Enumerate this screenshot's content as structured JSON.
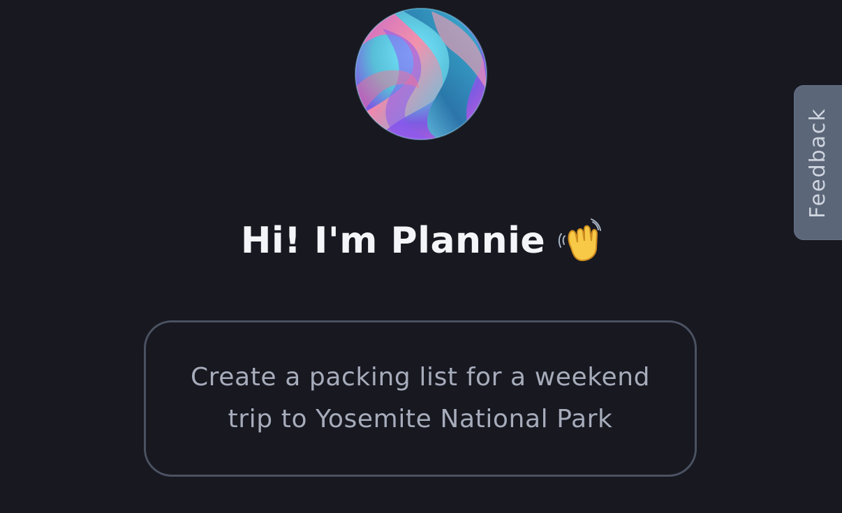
{
  "assistant": {
    "name_heading": "Hi! I'm Plannie",
    "avatar_icon": "gradient-orb-avatar",
    "greeting_icon": "waving-hand-icon"
  },
  "suggestion": {
    "text": "Create a packing list for a weekend trip to Yosemite National Park"
  },
  "feedback": {
    "label": "Feedback"
  },
  "colors": {
    "background": "#171820",
    "card_border": "#4b5261",
    "feedback_tab": "#5b6678",
    "heading_text": "#f4f5f8",
    "suggestion_text": "#a7acbb"
  }
}
